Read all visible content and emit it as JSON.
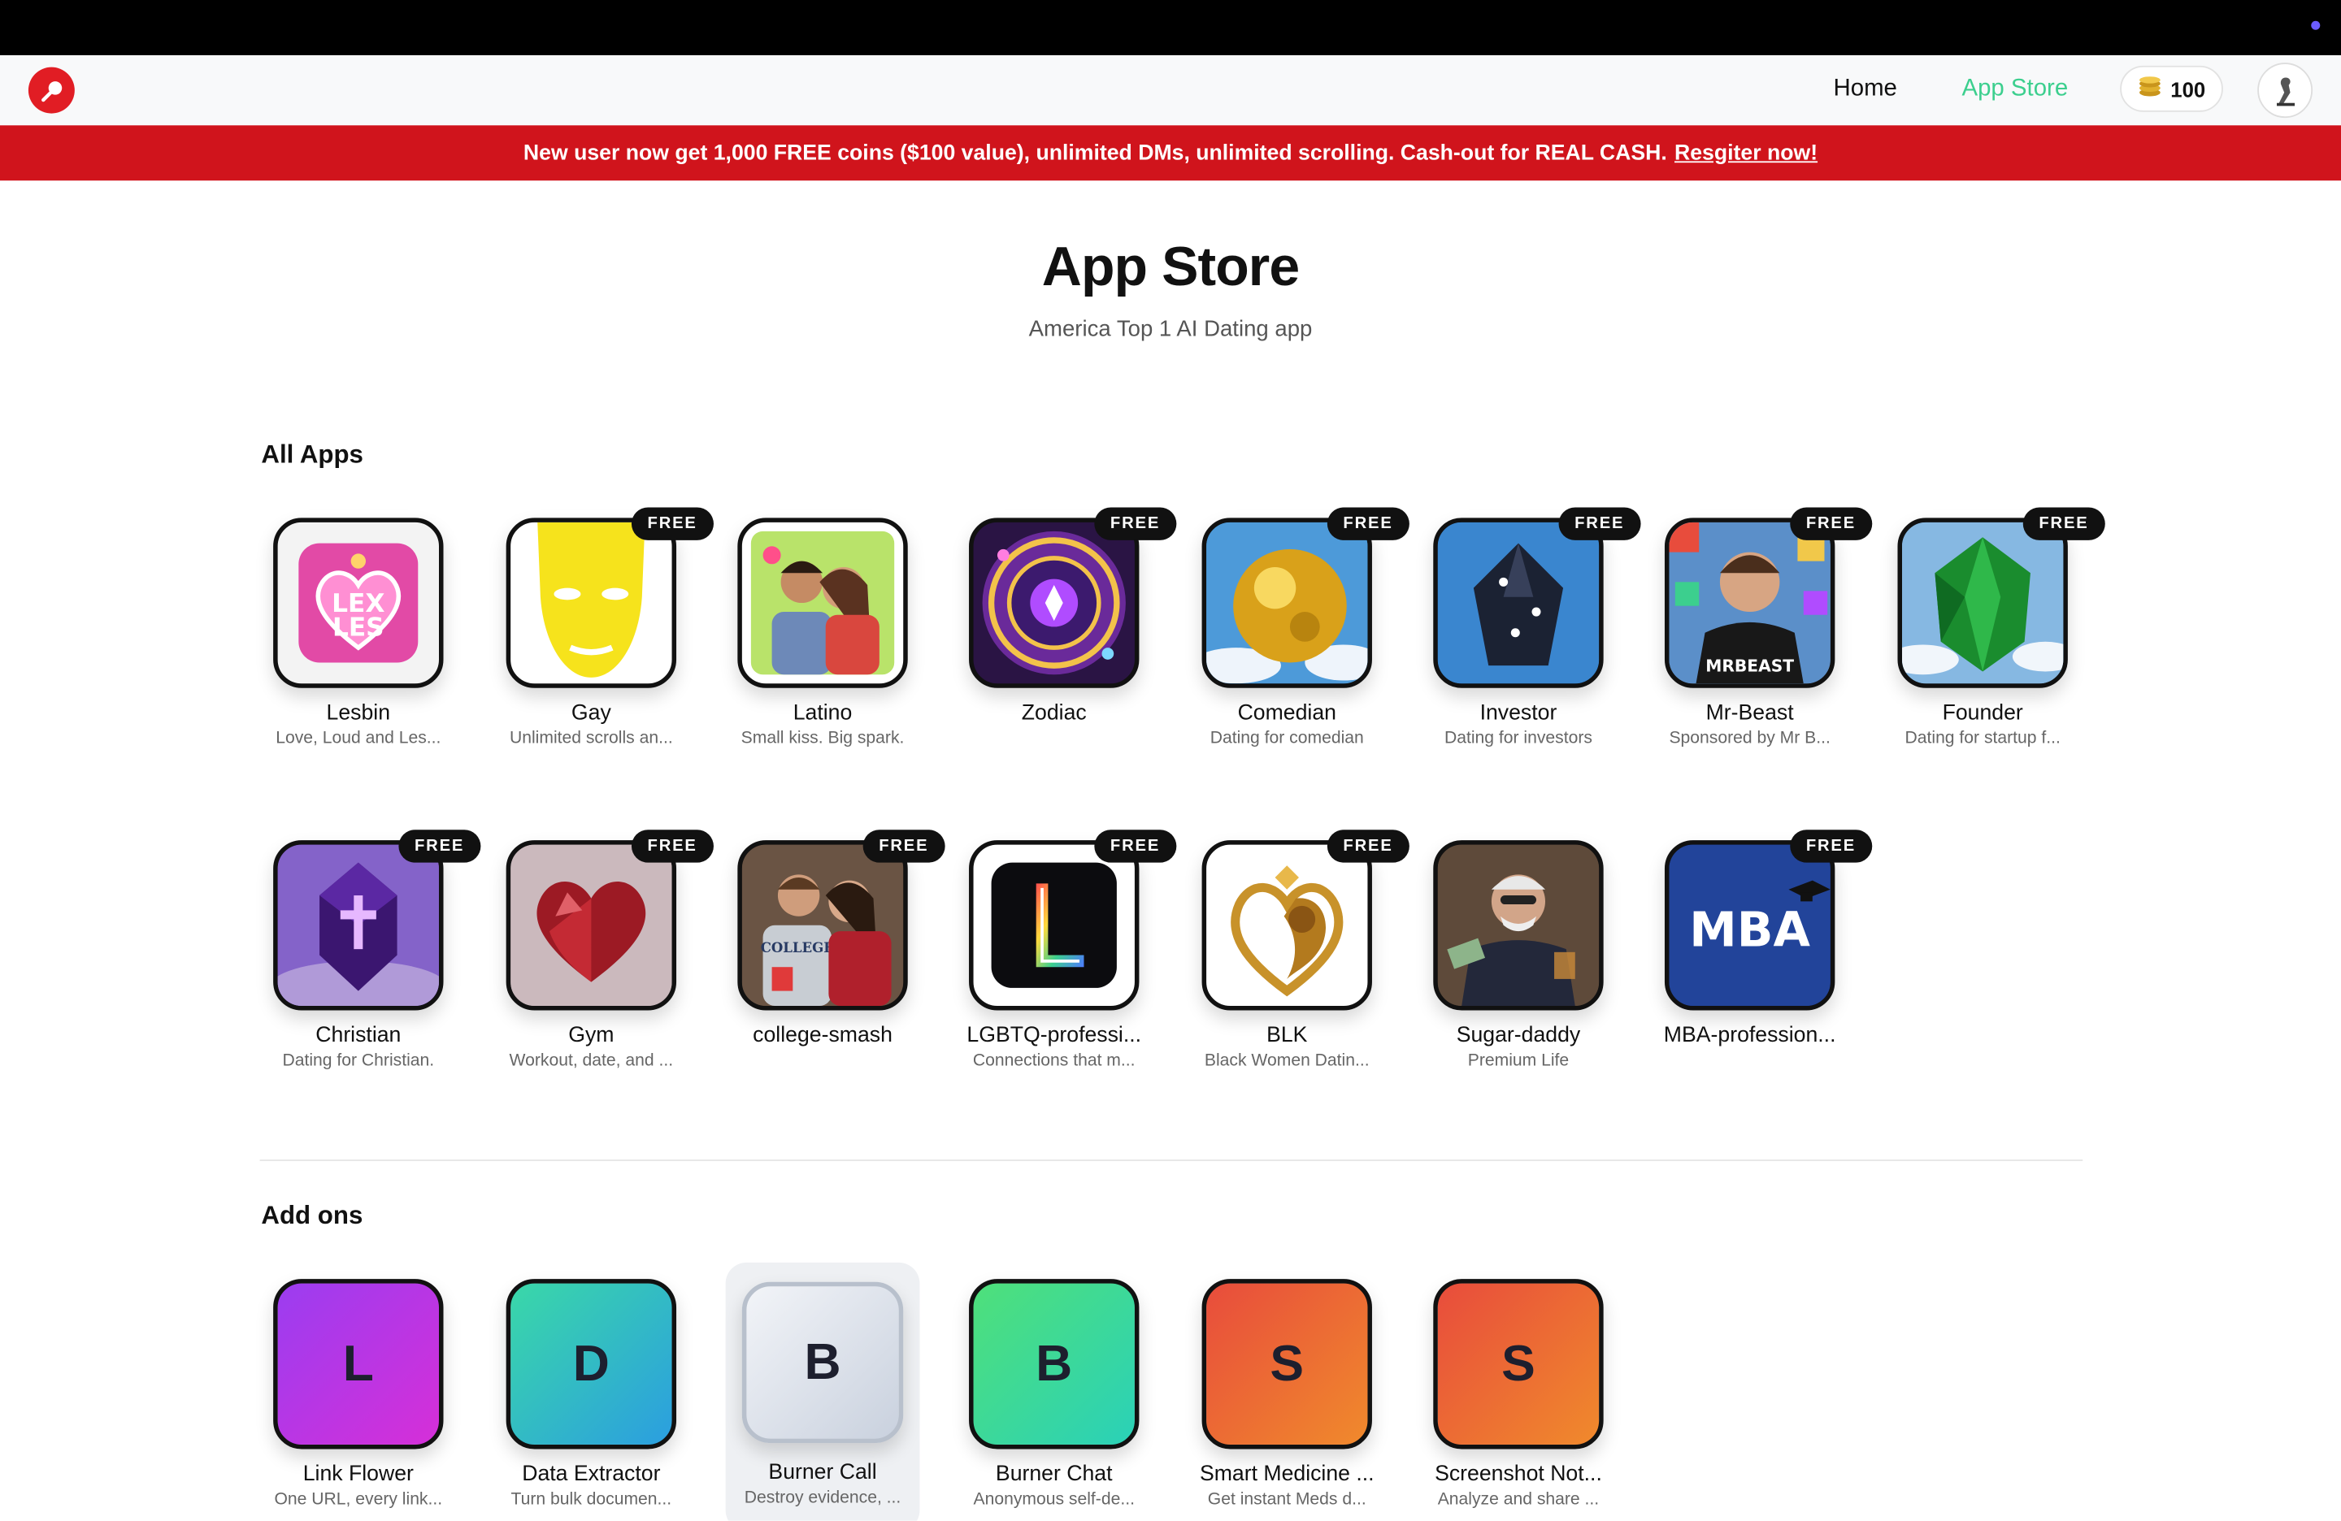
{
  "nav": {
    "home_label": "Home",
    "store_label": "App Store",
    "coins": "100",
    "accent": "#3ccf8e"
  },
  "banner": {
    "text": "New user now get 1,000 FREE coins ($100 value), unlimited DMs, unlimited scrolling. Cash-out for REAL CASH.",
    "link": "Resgiter now!",
    "color": "#d0141c"
  },
  "page": {
    "title": "App Store",
    "subtitle": "America Top 1 AI Dating app"
  },
  "sections": {
    "all_apps": "All Apps",
    "addons": "Add ons"
  },
  "apps": [
    {
      "name": "Lesbin",
      "desc": "Love, Loud and Les...",
      "free": false,
      "icon": "lex-les-heart-icon"
    },
    {
      "name": "Gay",
      "desc": "Unlimited scrolls an...",
      "free": true,
      "icon": "yellow-mask-icon"
    },
    {
      "name": "Latino",
      "desc": "Small kiss. Big spark.",
      "free": false,
      "icon": "couple-photo-icon"
    },
    {
      "name": "Zodiac",
      "desc": "",
      "free": true,
      "icon": "zodiac-wheel-icon"
    },
    {
      "name": "Comedian",
      "desc": "Dating for comedian",
      "free": true,
      "icon": "gold-sphere-icon"
    },
    {
      "name": "Investor",
      "desc": "Dating for investors",
      "free": true,
      "icon": "dark-crystal-icon"
    },
    {
      "name": "Mr-Beast",
      "desc": "Sponsored by Mr B...",
      "free": true,
      "icon": "mr-beast-photo-icon"
    },
    {
      "name": "Founder",
      "desc": "Dating for startup f...",
      "free": true,
      "icon": "emerald-icon"
    },
    {
      "name": "Christian",
      "desc": "Dating for Christian.",
      "free": true,
      "icon": "purple-cross-gem-icon"
    },
    {
      "name": "Gym",
      "desc": "Workout, date, and ...",
      "free": true,
      "icon": "ruby-heart-icon"
    },
    {
      "name": "college-smash",
      "desc": "",
      "free": true,
      "icon": "college-couple-photo-icon"
    },
    {
      "name": "LGBTQ-professi...",
      "desc": "Connections that m...",
      "free": true,
      "icon": "letter-l-rainbow-icon"
    },
    {
      "name": "BLK",
      "desc": "Black Women Datin...",
      "free": true,
      "icon": "golden-heart-woman-icon"
    },
    {
      "name": "Sugar-daddy",
      "desc": "Premium Life",
      "free": false,
      "icon": "sugar-daddy-photo-icon"
    },
    {
      "name": "MBA-profession...",
      "desc": "",
      "free": true,
      "icon": "mba-cap-icon",
      "icon_text": "MBA"
    }
  ],
  "badge_label": "FREE",
  "addons": [
    {
      "name": "Link Flower",
      "desc": "One URL, every link...",
      "letter": "L",
      "icon": "letter-l-icon",
      "grad": [
        "#9b3df0",
        "#d62fd8"
      ]
    },
    {
      "name": "Data Extractor",
      "desc": "Turn bulk documen...",
      "letter": "D",
      "icon": "letter-d-icon",
      "grad": [
        "#3ad8a8",
        "#2b9ee0"
      ]
    },
    {
      "name": "Burner Call",
      "desc": "Destroy evidence, ...",
      "letter": "B",
      "icon": "letter-b-icon",
      "grad": [
        "#f2f4f8",
        "#c9d1de"
      ]
    },
    {
      "name": "Burner Chat",
      "desc": "Anonymous self-de...",
      "letter": "B",
      "icon": "letter-b-icon",
      "grad": [
        "#4fe07a",
        "#2ad1b8"
      ]
    },
    {
      "name": "Smart Medicine ...",
      "desc": "Get instant Meds d...",
      "letter": "S",
      "icon": "letter-s-icon",
      "grad": [
        "#e84c3c",
        "#f08a2c"
      ]
    },
    {
      "name": "Screenshot Not...",
      "desc": "Analyze and share ...",
      "letter": "S",
      "icon": "letter-s-icon",
      "grad": [
        "#e84c3c",
        "#f08a2c"
      ]
    }
  ]
}
